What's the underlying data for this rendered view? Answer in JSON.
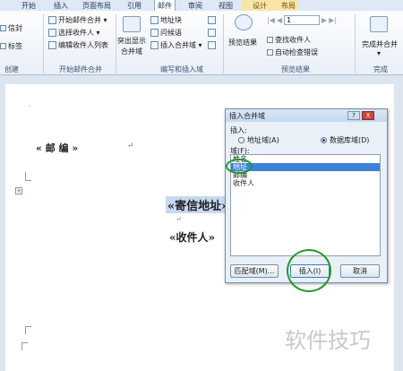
{
  "tabs": {
    "items": [
      "开始",
      "插入",
      "页面布局",
      "引用",
      "邮件",
      "审阅",
      "视图",
      "设计",
      "布局"
    ]
  },
  "ribbon": {
    "left_cut": {
      "envelope": "信封",
      "label": "标签"
    },
    "start_merge": {
      "start": "开始邮件合并 ▾",
      "select": "选择收件人 ▾",
      "edit": "编辑收件人列表"
    },
    "fields": {
      "highlight_1": "突出显示",
      "highlight_2": "合并域",
      "address": "地址块",
      "greeting": "问候语",
      "insert_field": "插入合并域 ▾"
    },
    "preview": {
      "preview_results": "预览结果",
      "record_no": "1",
      "find": "查找收件人",
      "auto_check": "自动检查错误"
    },
    "finish": {
      "finish_merge": "完成并合并",
      "dropdown": "▾"
    },
    "groups": [
      "创建",
      "开始邮件合并",
      "编写和插入域",
      "预览结果",
      "完成"
    ]
  },
  "document": {
    "postcode": "«   邮       编   »",
    "return_mark": "↵",
    "sender_field": "«寄信地址»",
    "recipient_field": "«收件人»"
  },
  "dialog": {
    "title": "插入合并域",
    "help": "?",
    "close": "X",
    "insert_label": "插入:",
    "radio_address": "地址域(A)",
    "radio_database": "数据库域(D)",
    "fields_label": "域(F):",
    "fields": [
      "姓名",
      "地址",
      "邮编",
      "收件人"
    ],
    "selected_index": 1,
    "match_button": "匹配域(M)...",
    "insert_button": "插入(I)",
    "cancel_button": "取消"
  },
  "watermark": "软件技巧",
  "colors": {
    "selection": "#3d82d8",
    "highlight_green": "#1f9a2a",
    "field_shade": "#c6d9f1"
  }
}
